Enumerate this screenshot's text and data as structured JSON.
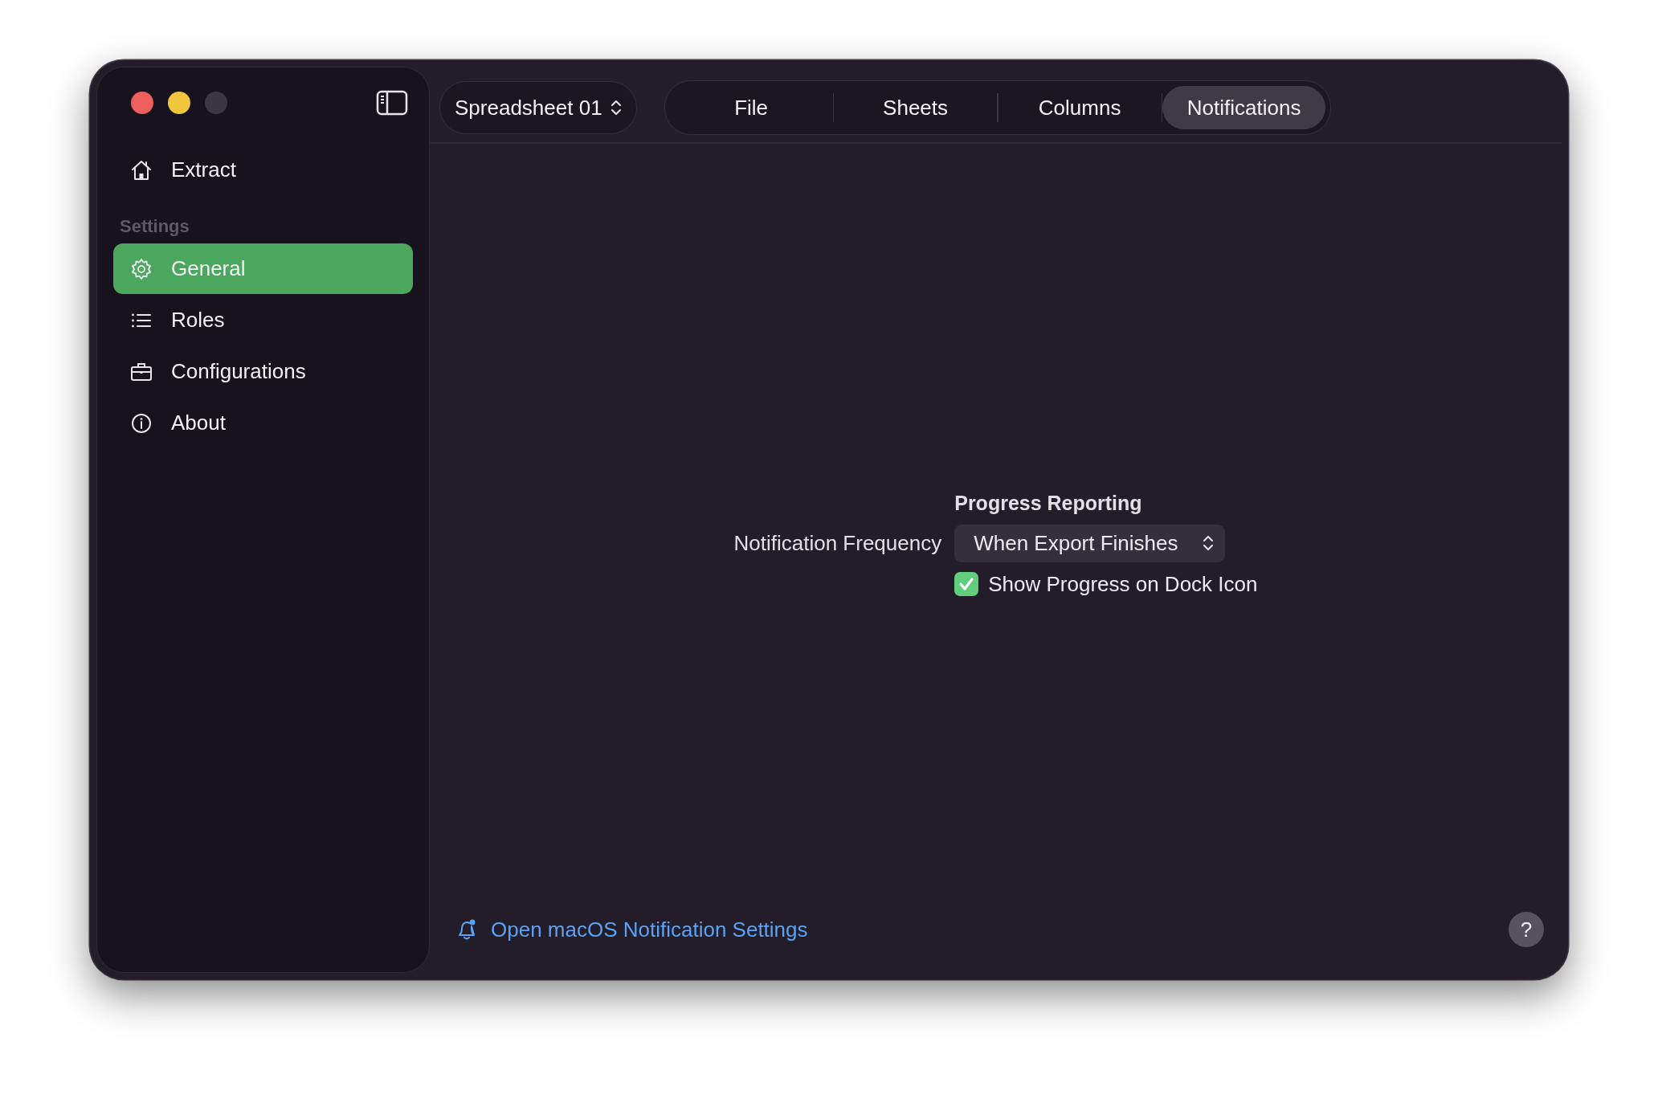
{
  "sidebar": {
    "items": [
      {
        "label": "Extract",
        "selected": false
      }
    ],
    "section": {
      "title": "Settings",
      "items": [
        {
          "label": "General",
          "selected": true
        },
        {
          "label": "Roles",
          "selected": false
        },
        {
          "label": "Configurations",
          "selected": false
        },
        {
          "label": "About",
          "selected": false
        }
      ]
    }
  },
  "toolbar": {
    "document_picker": {
      "value": "Spreadsheet 01"
    },
    "tabs": [
      {
        "label": "File",
        "selected": false
      },
      {
        "label": "Sheets",
        "selected": false
      },
      {
        "label": "Columns",
        "selected": false
      },
      {
        "label": "Notifications",
        "selected": true
      }
    ]
  },
  "content": {
    "section_title": "Progress Reporting",
    "rows": [
      {
        "kind": "popup",
        "label": "Notification Frequency",
        "value": "When Export Finishes"
      },
      {
        "kind": "checkbox",
        "label": "Show Progress on Dock Icon",
        "checked": true
      }
    ]
  },
  "footer": {
    "link": "Open macOS Notification Settings",
    "help": "?"
  }
}
